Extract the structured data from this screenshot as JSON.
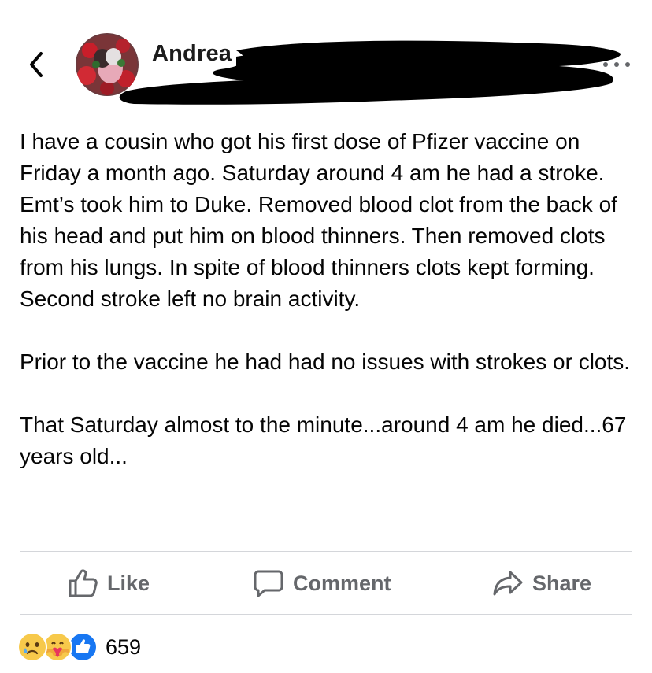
{
  "header": {
    "author_name": "Andrea",
    "icons": {
      "back": "chevron-left-icon",
      "more": "more-horizontal-icon",
      "avatar": "profile-photo"
    }
  },
  "post": {
    "paragraphs": [
      "I have a cousin who got his first dose of Pfizer vaccine on Friday a month ago. Saturday around 4 am he had a stroke. Emt’s took him to Duke. Removed blood clot from the back of his head and put him on blood thinners. Then removed clots from his lungs. In spite of blood thinners clots kept forming. Second stroke left no brain activity.",
      "Prior to the vaccine he had had no issues with strokes or clots.",
      "That Saturday almost to the minute...around 4 am he died...67 years old..."
    ]
  },
  "actions": {
    "like_label": "Like",
    "comment_label": "Comment",
    "share_label": "Share"
  },
  "reactions": {
    "types": [
      "sad",
      "care",
      "like"
    ],
    "count": "659"
  },
  "colors": {
    "text": "#050505",
    "secondary": "#65676b",
    "like_blue": "#1877f2",
    "reaction_yellow": "#f7c94b"
  }
}
